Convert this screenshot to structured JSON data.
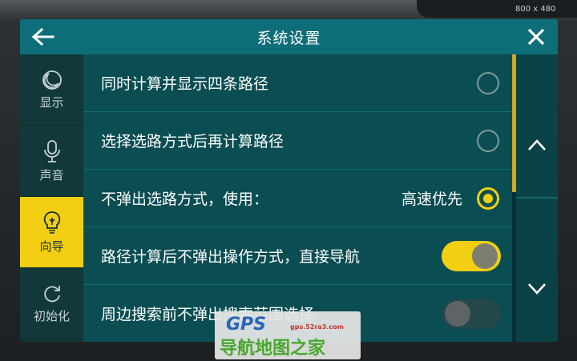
{
  "screen": {
    "resolution_label": "800 x 480"
  },
  "header": {
    "title": "系统设置",
    "back_icon": "arrow-left-icon",
    "close_icon": "close-icon"
  },
  "sidebar": {
    "items": [
      {
        "label": "显示",
        "icon": "moon-icon",
        "active": false
      },
      {
        "label": "声音",
        "icon": "microphone-icon",
        "active": false
      },
      {
        "label": "向导",
        "icon": "lightbulb-icon",
        "active": true
      },
      {
        "label": "初始化",
        "icon": "refresh-icon",
        "active": false
      }
    ]
  },
  "settings": {
    "rows": [
      {
        "label": "同时计算并显示四条路径",
        "control": "radio",
        "checked": false
      },
      {
        "label": "选择选路方式后再计算路径",
        "control": "radio",
        "checked": false
      },
      {
        "label": "不弹出选路方式，使用：",
        "extra": "高速优先",
        "control": "radio",
        "checked": true
      },
      {
        "label": "路径计算后不弹出操作方式，直接导航",
        "control": "toggle",
        "on": true
      },
      {
        "label": "周边搜索前不弹出搜索范围选择",
        "control": "toggle",
        "on": false
      }
    ]
  },
  "scroll": {
    "up_icon": "chevron-up-icon",
    "down_icon": "chevron-down-icon"
  },
  "watermark": {
    "brand": "GPS",
    "url": "gps.52ra3.com",
    "text": "导航地图之家"
  },
  "colors": {
    "accent": "#f2cf12",
    "header": "#0d6e79",
    "content": "#0a4d52",
    "sidebar": "#12383b"
  }
}
